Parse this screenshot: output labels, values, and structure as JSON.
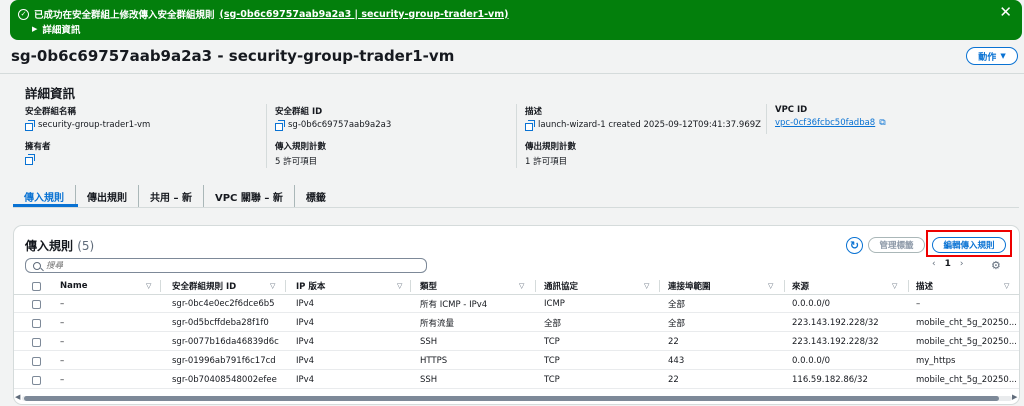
{
  "flash": {
    "message": "已成功在安全群組上修改傳入安全群組規則",
    "link": "(sg-0b6c69757aab9a2a3 | security-group-trader1-vm)",
    "details": "詳細資訊"
  },
  "header": {
    "title": "sg-0b6c69757aab9a2a3 - security-group-trader1-vm",
    "actions_label": "動作"
  },
  "details": {
    "title": "詳細資訊",
    "group_name_label": "安全群組名稱",
    "group_name": "security-group-trader1-vm",
    "group_id_label": "安全群組 ID",
    "group_id": "sg-0b6c69757aab9a2a3",
    "desc_label": "描述",
    "desc": "launch-wizard-1 created 2025-09-12T09:41:37.969Z",
    "vpc_label": "VPC ID",
    "vpc": "vpc-0cf36fcbc50fadba8",
    "owner_label": "擁有者",
    "inbound_count_label": "傳入規則計數",
    "inbound_count": "5 許可項目",
    "outbound_count_label": "傳出規則計數",
    "outbound_count": "1 許可項目"
  },
  "tabs": [
    {
      "label": "傳入規則"
    },
    {
      "label": "傳出規則"
    },
    {
      "label": "共用 – 新"
    },
    {
      "label": "VPC 關聯 – 新"
    },
    {
      "label": "標籤"
    }
  ],
  "table": {
    "title": "傳入規則",
    "count": "(5)",
    "manage_label": "管理標籤",
    "edit_label": "編輯傳入規則",
    "search_placeholder": "搜尋",
    "page": "1",
    "columns": [
      "Name",
      "安全群組規則 ID",
      "IP 版本",
      "類型",
      "通訊協定",
      "連接埠範圍",
      "來源",
      "描述"
    ],
    "rows": [
      {
        "name": "–",
        "id": "sgr-0bc4e0ec2f6dce6b5",
        "ip": "IPv4",
        "type": "所有 ICMP - IPv4",
        "proto": "ICMP",
        "port": "全部",
        "source": "0.0.0.0/0",
        "desc": "–"
      },
      {
        "name": "–",
        "id": "sgr-0d5bcffdeba28f1f0",
        "ip": "IPv4",
        "type": "所有流量",
        "proto": "全部",
        "port": "全部",
        "source": "223.143.192.228/32",
        "desc": "mobile_cht_5g_20250..."
      },
      {
        "name": "–",
        "id": "sgr-0077b16da46839d6c",
        "ip": "IPv4",
        "type": "SSH",
        "proto": "TCP",
        "port": "22",
        "source": "223.143.192.228/32",
        "desc": "mobile_cht_5g_20250..."
      },
      {
        "name": "–",
        "id": "sgr-01996ab791f6c17cd",
        "ip": "IPv4",
        "type": "HTTPS",
        "proto": "TCP",
        "port": "443",
        "source": "0.0.0.0/0",
        "desc": "my_https"
      },
      {
        "name": "–",
        "id": "sgr-0b70408548002efee",
        "ip": "IPv4",
        "type": "SSH",
        "proto": "TCP",
        "port": "22",
        "source": "116.59.182.86/32",
        "desc": "mobile_cht_5g_20250..."
      }
    ]
  }
}
